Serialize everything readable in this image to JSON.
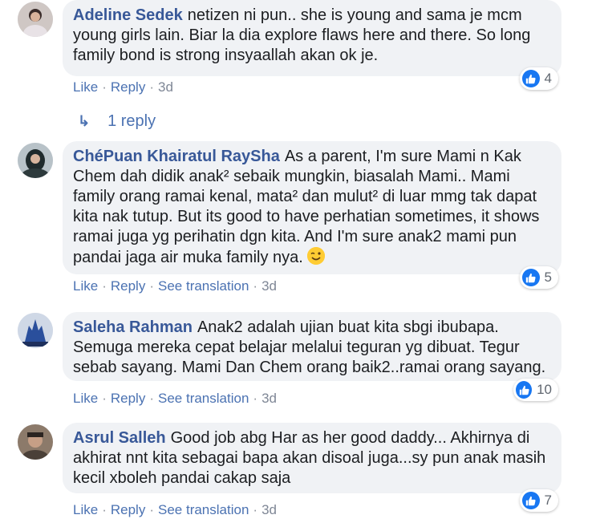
{
  "comments": [
    {
      "author": "Adeline Sedek",
      "text": "netizen ni pun.. she is young and sama je mcm young girls lain. Biar la dia explore flaws here and there. So long family bond is strong insyaallah akan ok je.",
      "like_label": "Like",
      "reply_label": "Reply",
      "time": "3d",
      "reaction_count": "4",
      "replies_label": "1 reply",
      "avatar_icon": "profile-photo"
    },
    {
      "author": "ChéPuan Khairatul RaySha",
      "text": "As a parent, I'm sure Mami n Kak Chem dah didik anak² sebaik mungkin, biasalah Mami.. Mami family orang ramai kenal, mata² dan mulut² di luar mmg tak dapat kita nak tutup. But its good to have perhatian sometimes, it shows ramai juga yg perihatin dgn kita. And I'm sure anak2 mami pun pandai jaga air muka family nya.",
      "emoji": "wink-emoji",
      "like_label": "Like",
      "reply_label": "Reply",
      "translation_label": "See translation",
      "time": "3d",
      "reaction_count": "5"
    },
    {
      "author": "Saleha Rahman",
      "text": "Anak2 adalah ujian buat kita sbgi ibubapa. Semuga mereka cepat belajar melalui teguran yg dibuat. Tegur sebab sayang. Mami Dan Chem orang baik2..ramai orang sayang.",
      "like_label": "Like",
      "reply_label": "Reply",
      "translation_label": "See translation",
      "time": "3d",
      "reaction_count": "10"
    },
    {
      "author": "Asrul Salleh",
      "text": "Good job abg Har as her good daddy... Akhirnya di akhirat nnt kita sebagai bapa akan disoal juga...sy pun anak masih kecil xboleh pandai cakap saja",
      "like_label": "Like",
      "reply_label": "Reply",
      "translation_label": "See translation",
      "time": "3d",
      "reaction_count": "7"
    }
  ],
  "colors": {
    "author": "#385898",
    "action_link": "#4b72b2",
    "bubble_bg": "#f0f2f5",
    "like_blue": "#1877f2"
  }
}
